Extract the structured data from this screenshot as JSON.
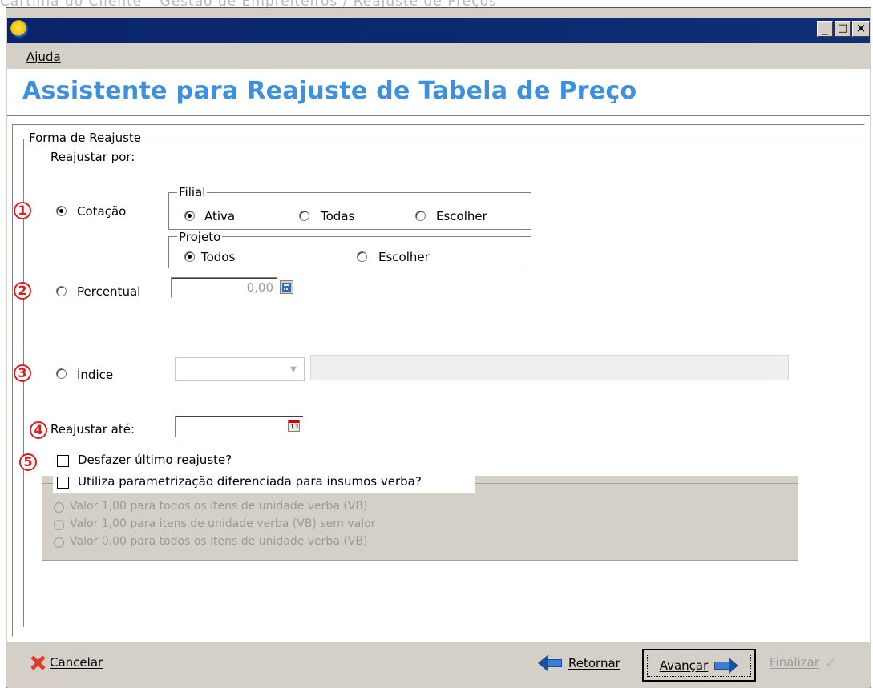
{
  "doc_title": "Cartilha do Cliente – Gestão de Empreiteiros / Reajuste de Preços",
  "window": {
    "buttons": {
      "minimize": "_",
      "maximize": "□",
      "close": "×"
    }
  },
  "menu": {
    "items": [
      {
        "label": "Ajuda"
      }
    ]
  },
  "header": {
    "title": "Assistente para Reajuste de Tabela de Preço"
  },
  "form": {
    "group_title": "Forma de Reajuste",
    "subtitle": "Reajustar por:",
    "steps": [
      "1",
      "2",
      "3",
      "4",
      "5"
    ],
    "cotacao": {
      "label": "Cotação",
      "selected": true,
      "filial": {
        "title": "Filial",
        "options": [
          "Ativa",
          "Todas",
          "Escolher"
        ],
        "selected": "Ativa"
      },
      "projeto": {
        "title": "Projeto",
        "options": [
          "Todos",
          "Escolher"
        ],
        "selected": "Todos"
      }
    },
    "percentual": {
      "label": "Percentual",
      "value": "0,00"
    },
    "indice": {
      "label": "Índice",
      "value": "",
      "description": ""
    },
    "reajustar_ate": {
      "label": "Reajustar até:",
      "value": ""
    },
    "desfazer": {
      "label": "Desfazer último reajuste?",
      "checked": false
    },
    "verba": {
      "label": "Utiliza parametrização diferenciada para insumos verba?",
      "checked": false,
      "options": [
        "Valor 1,00 para todos os itens de unidade verba (VB)",
        "Valor 1,00 para itens de unidade verba (VB) sem valor",
        "Valor 0,00 para todos os itens de unidade verba (VB)"
      ]
    }
  },
  "footer": {
    "cancel": "Cancelar",
    "back": "Retornar",
    "next": "Avançar",
    "finish": "Finalizar"
  },
  "colors": {
    "title_blue": "#3d8fe0",
    "titlebar": "#0a246a",
    "step_red": "#e01c1c",
    "window_gray": "#d4d0c8"
  }
}
